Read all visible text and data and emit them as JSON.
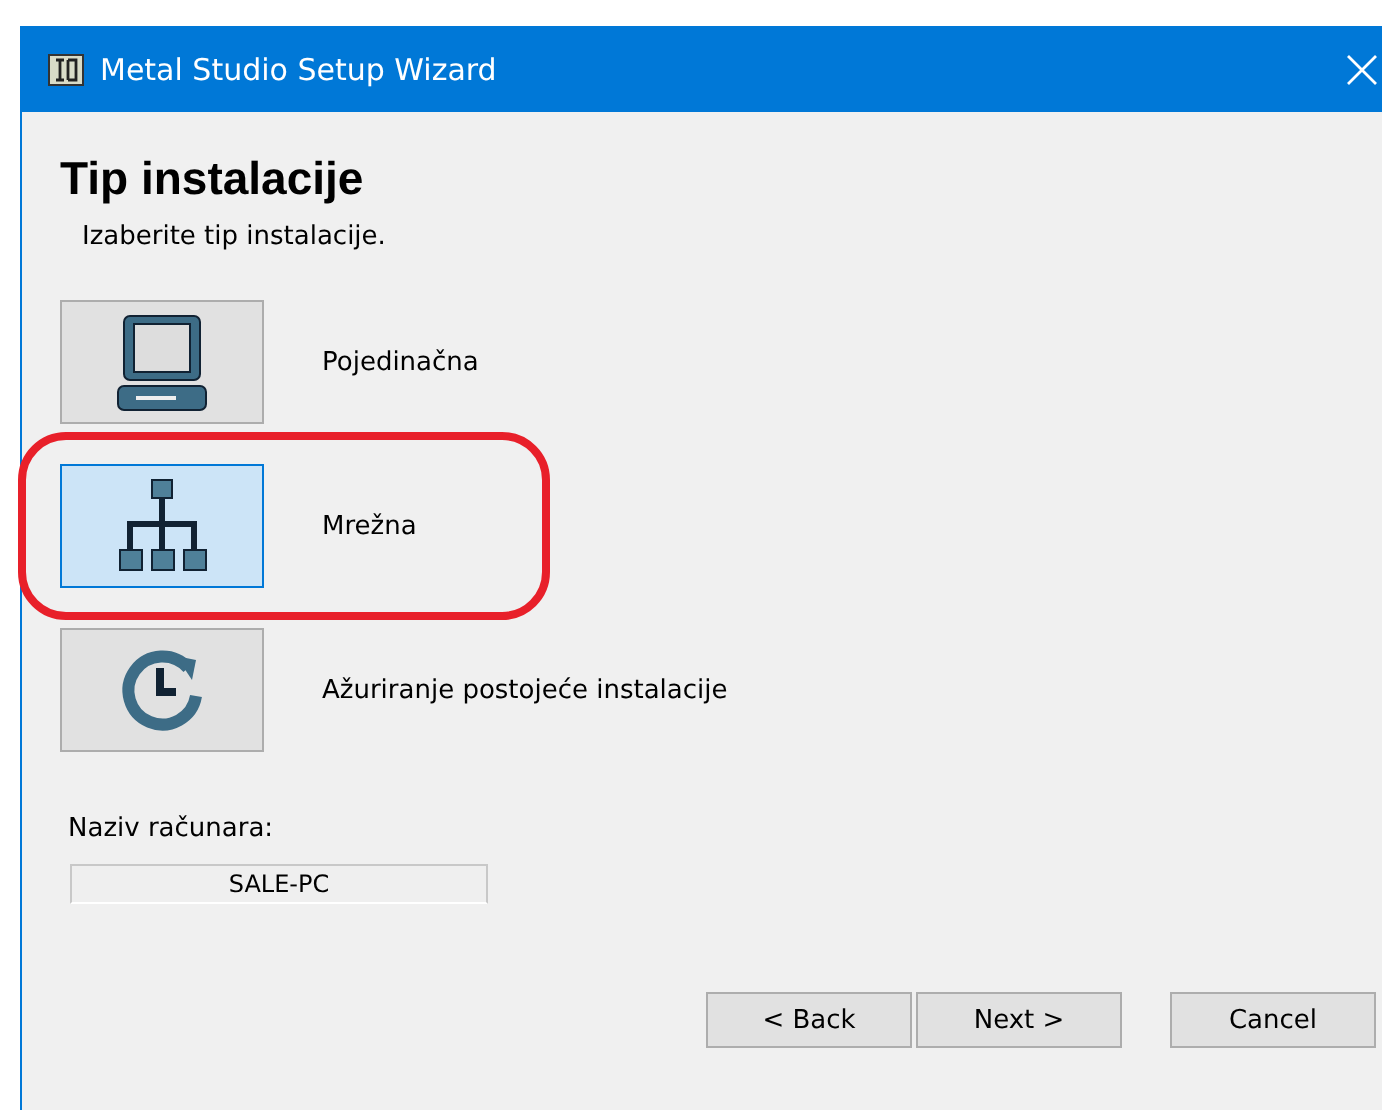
{
  "window": {
    "title": "Metal Studio Setup Wizard"
  },
  "heading": "Tip instalacije",
  "subheading": "Izaberite tip instalacije.",
  "options": [
    {
      "kind": "computer",
      "label": "Pojedinačna",
      "selected": false,
      "circled": false
    },
    {
      "kind": "network",
      "label": "Mrežna",
      "selected": true,
      "circled": true
    },
    {
      "kind": "update",
      "label": "Ažuriranje postojeće instalacije",
      "selected": false,
      "circled": false
    }
  ],
  "computer_name": {
    "label": "Naziv računara:",
    "value": "SALE-PC"
  },
  "buttons": [
    {
      "label": "< Back"
    },
    {
      "label": "Next >"
    },
    {
      "label": "Cancel"
    }
  ]
}
